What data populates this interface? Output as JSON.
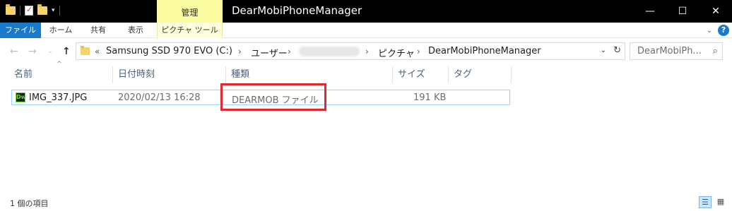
{
  "window": {
    "title": "DearMobiPhoneManager",
    "contextual_group": "管理",
    "controls": {
      "minimize": "—",
      "maximize": "☐",
      "close": "✕"
    }
  },
  "ribbon": {
    "tabs": [
      "ファイル",
      "ホーム",
      "共有",
      "表示",
      "ピクチャ ツール"
    ],
    "collapse_glyph": "⌄",
    "help_glyph": "?"
  },
  "navigation": {
    "back": "←",
    "forward": "→",
    "recent": "⌄",
    "up": "↑",
    "overflow": "«",
    "breadcrumbs": [
      "Samsung SSD 970 EVO (C:)",
      "ユーザー",
      "",
      "ピクチャ",
      "DearMobiPhoneManager"
    ],
    "separator": "›",
    "dropdown": "⌄",
    "refresh": "↻"
  },
  "search": {
    "placeholder": "DearMobiPh...",
    "icon": "⌕"
  },
  "columns": [
    "名前",
    "日付時刻",
    "種類",
    "サイズ",
    "タグ"
  ],
  "sort_indicator": "^",
  "files": [
    {
      "name": "IMG_337.JPG",
      "date": "2020/02/13 16:28",
      "type": "DEARMOB ファイル",
      "size": "191 KB",
      "icon": "Dw"
    }
  ],
  "status": {
    "item_count": "1 個の項目",
    "details_view_glyph": "☰",
    "tiles_view_glyph": "▦"
  },
  "colors": {
    "accent": "#1979ca",
    "picture_tools": "#fafaa0",
    "highlight": "#e0282e",
    "selection_border": "#99d1ff"
  }
}
